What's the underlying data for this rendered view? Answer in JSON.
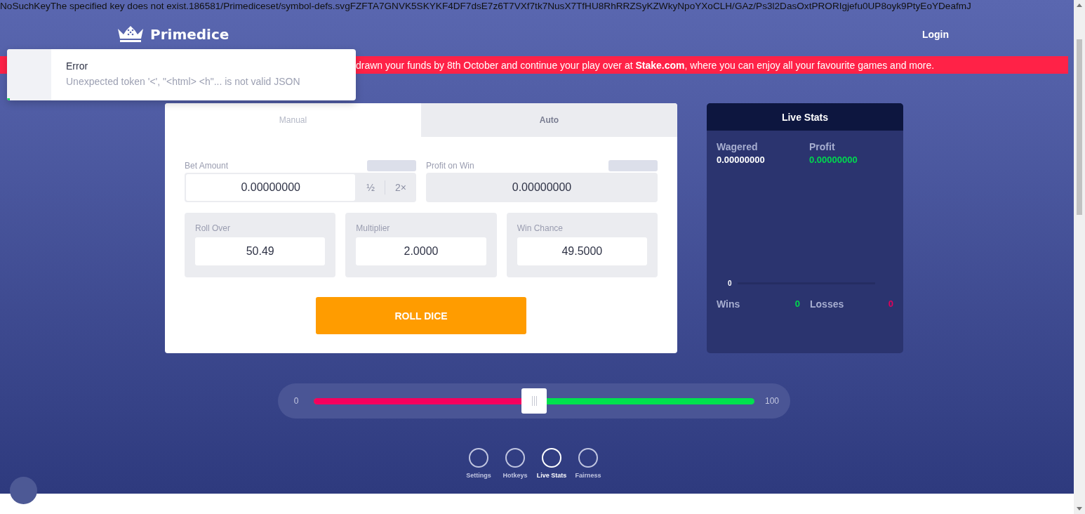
{
  "error_line": "NoSuchKeyThe specified key does not exist.186581/Primediceset/symbol-defs.svgFZFTA7GNVK5SKYKF4DF7dsE7z6T7VXf7tk7NusX7TfHU8RhRRZSyKZWkyNpoYXoCLH/GAz/Ps3l2DasOxtPRORIgjefu0UP8oyk9PtyEoYDeafmJ",
  "header": {
    "brand": "Primedice",
    "login": "Login"
  },
  "banner": {
    "text": "drawn your funds by 8th October and continue your play over at **Stake.com**, where you can enjoy all your favourite games and more."
  },
  "toast": {
    "title": "Error",
    "message": "Unexpected token '<', \"<html> <h\"... is not valid JSON",
    "level": 0.06
  },
  "bet_panel": {
    "tabs": [
      {
        "label": "Manual",
        "selected": true
      },
      {
        "label": "Auto",
        "selected": false
      }
    ],
    "bet_amount": {
      "label": "Bet Amount",
      "value": "0.00000000",
      "half": "½",
      "double": "2×"
    },
    "profit_on_win": {
      "label": "Profit on Win",
      "value": "0.00000000"
    },
    "fields": [
      {
        "label": "Roll Over",
        "value": "50.49"
      },
      {
        "label": "Multiplier",
        "value": "2.0000"
      },
      {
        "label": "Win Chance",
        "value": "49.5000"
      }
    ],
    "roll_button": "ROLL DICE"
  },
  "live_stats": {
    "title": "Live Stats",
    "wagered": {
      "label": "Wagered",
      "value": "0.00000000"
    },
    "profit": {
      "label": "Profit",
      "value": "0.00000000"
    },
    "axis_label": "0",
    "wins": {
      "label": "Wins",
      "value": "0"
    },
    "losses": {
      "label": "Losses",
      "value": "0"
    }
  },
  "slider": {
    "min": "0",
    "max": "100",
    "level": 0.5
  },
  "bottom_nav": [
    {
      "label": "Settings",
      "selected": false
    },
    {
      "label": "Hotkeys",
      "selected": false
    },
    {
      "label": "Live Stats",
      "selected": true
    },
    {
      "label": "Fairness",
      "selected": false
    }
  ]
}
